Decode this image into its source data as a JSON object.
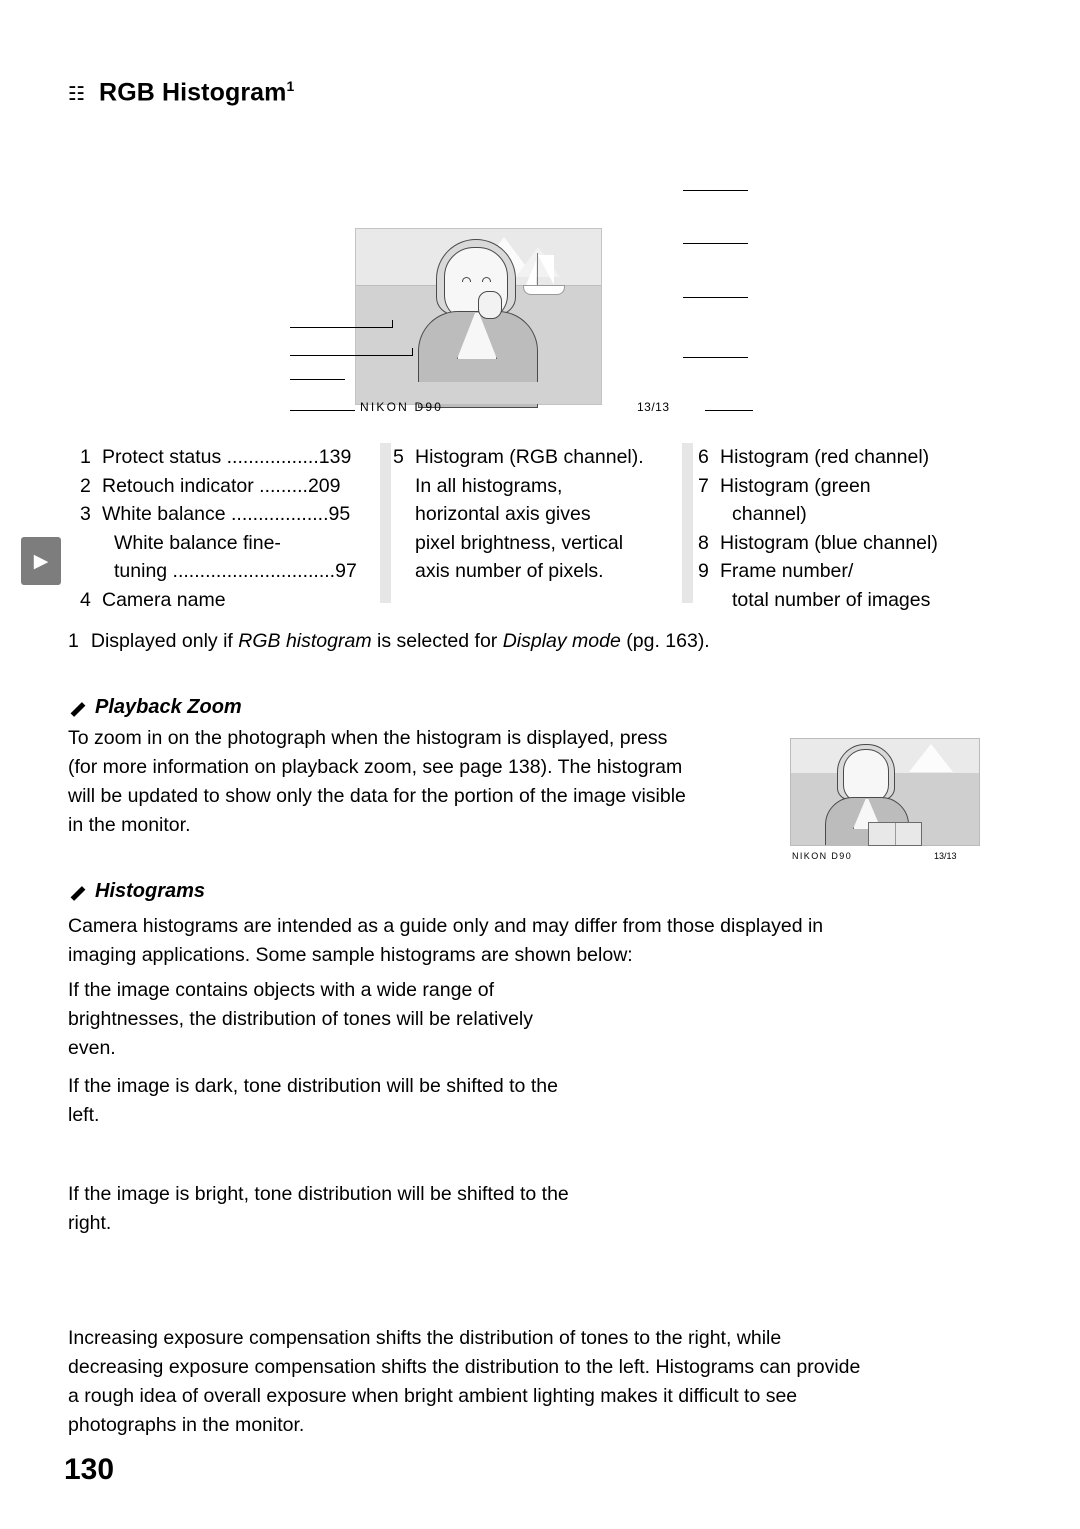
{
  "page": {
    "number": "130",
    "title_glyph": "☷",
    "title": "RGB Histogram",
    "title_superscript": "1"
  },
  "monitor": {
    "camera_name": "NIKON D90",
    "frame_counter": "13/13"
  },
  "callouts": {
    "column_a": [
      {
        "num": "1",
        "label": "Protect status",
        "dots": " .................",
        "page": "139"
      },
      {
        "num": "2",
        "label": "Retouch indicator",
        "dots": " .........",
        "page": "209"
      },
      {
        "num": "3",
        "label": "White balance",
        "dots": " ..................",
        "page": "95"
      },
      {
        "num": "",
        "label": "White balance fine-",
        "dots": "",
        "page": ""
      },
      {
        "num": "",
        "label": "tuning",
        "dots": " ..............................",
        "page": "97"
      },
      {
        "num": "4",
        "label": "Camera name",
        "dots": "",
        "page": ""
      }
    ],
    "column_b": [
      {
        "num": "5",
        "label": "Histogram (RGB channel)."
      },
      {
        "num": "",
        "label": "In all histograms,"
      },
      {
        "num": "",
        "label": "horizontal axis gives"
      },
      {
        "num": "",
        "label": "pixel brightness, vertical"
      },
      {
        "num": "",
        "label": "axis number of pixels."
      }
    ],
    "column_c": [
      {
        "num": "6",
        "label": "Histogram (red channel)"
      },
      {
        "num": "7",
        "label": "Histogram (green"
      },
      {
        "num": "",
        "label": "channel)"
      },
      {
        "num": "8",
        "label": "Histogram (blue channel)"
      },
      {
        "num": "9",
        "label": "Frame number/"
      },
      {
        "num": "",
        "label": "total number of images"
      }
    ]
  },
  "footnote": {
    "num": "1",
    "part1": "Displayed only if ",
    "italic1": "RGB histogram",
    "part2": " is selected for ",
    "italic2": "Display mode",
    "part3": " (pg. 163)."
  },
  "notes": [
    {
      "heading": "Playback Zoom",
      "lines": [
        "To zoom in on the photograph when the histogram is displayed, press",
        "(for more information on playback zoom, see page 138).  The histogram",
        "will be updated to show only the data for the portion of the image visible",
        "in the monitor."
      ]
    },
    {
      "heading": "Histograms",
      "lines": [
        "Camera histograms are intended as a guide only and may differ from those displayed in",
        "imaging applications.  Some sample histograms are shown below:"
      ]
    }
  ],
  "samples": [
    {
      "lines": [
        "If the image contains objects with a wide range of",
        "brightnesses, the distribution of tones will be relatively",
        "even."
      ]
    },
    {
      "lines": [
        "If the image is dark, tone distribution will be shifted to the",
        "left."
      ]
    },
    {
      "lines": [
        "If the image is bright, tone distribution will be shifted to the",
        "right."
      ]
    }
  ],
  "closing": {
    "lines": [
      "Increasing exposure compensation shifts the distribution of tones to the right, while",
      "decreasing exposure compensation shifts the distribution to the left.  Histograms can provide",
      "a rough idea of overall exposure when bright ambient lighting makes it difficult to see",
      "photographs in the monitor."
    ]
  },
  "mini_monitor": {
    "camera_name": "NIKON D90",
    "frame_counter": "13/13"
  },
  "side_tab": {
    "glyph": "▶"
  }
}
